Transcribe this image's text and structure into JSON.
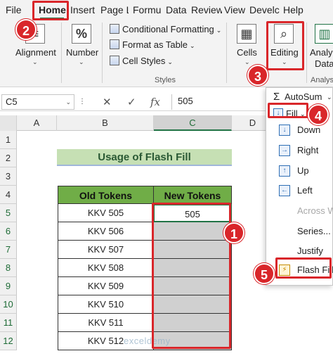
{
  "tabs": [
    "File",
    "Home",
    "Insert",
    "Page L",
    "Formu",
    "Data",
    "Review",
    "View",
    "Develc",
    "Help"
  ],
  "ribbon": {
    "alignment": "Alignment",
    "number": "Number",
    "number_icon": "%",
    "conditional_formatting": "Conditional Formatting",
    "format_as_table": "Format as Table",
    "cell_styles": "Cell Styles",
    "styles_group": "Styles",
    "cells": "Cells",
    "editing": "Editing",
    "analyze_1": "Analyz",
    "analyze_2": "Data",
    "analysis_group": "Analys"
  },
  "formula_bar": {
    "name_box": "C5",
    "cancel": "✕",
    "enter": "✓",
    "fx": "fx",
    "value": "505"
  },
  "columns": [
    "A",
    "B",
    "C",
    "D"
  ],
  "rows": [
    "1",
    "2",
    "3",
    "4",
    "5",
    "6",
    "7",
    "8",
    "9",
    "10",
    "11",
    "12"
  ],
  "sheet": {
    "title": "Usage of Flash Fill",
    "headers": [
      "Old Tokens",
      "New Tokens"
    ],
    "old_tokens": [
      "KKV 505",
      "KKV 506",
      "KKV 507",
      "KKV 508",
      "KKV 509",
      "KKV 510",
      "KKV 511",
      "KKV 512"
    ],
    "new_tokens": [
      "505",
      "",
      "",
      "",
      "",
      "",
      "",
      ""
    ]
  },
  "menu": {
    "autosum": "AutoSum",
    "fill": "Fill",
    "items": [
      "Down",
      "Right",
      "Up",
      "Left",
      "Across Wo",
      "Series...",
      "Justify",
      "Flash Fill"
    ]
  },
  "badges": [
    "1",
    "2",
    "3",
    "4",
    "5"
  ],
  "watermark": "exceldemy",
  "colors": {
    "accent": "#217346",
    "annotation_red": "#d9262a",
    "header_green": "#70ad47",
    "title_fill": "#c6e0b4"
  }
}
